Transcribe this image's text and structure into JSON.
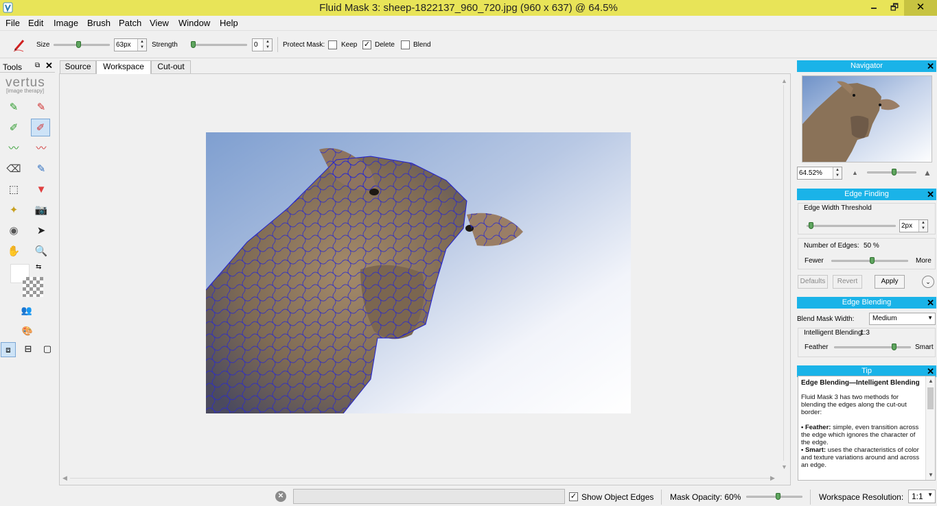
{
  "window": {
    "title": "Fluid Mask 3: sheep-1822137_960_720.jpg (960 x 637) @ 64.5%",
    "minimize_glyph": "🗕",
    "restore_glyph": "🗗",
    "close_glyph": "✕"
  },
  "menu": [
    "File",
    "Edit",
    "Image",
    "Brush",
    "Patch",
    "View",
    "Window",
    "Help"
  ],
  "toolbar": {
    "size_label": "Size",
    "size_value": "63px",
    "size_level": 0.4,
    "strength_label": "Strength",
    "strength_value": "0",
    "strength_level": 0.0,
    "protect_label": "Protect Mask:",
    "keep_label": "Keep",
    "keep_checked": false,
    "delete_label": "Delete",
    "delete_checked": true,
    "blend_label": "Blend",
    "blend_checked": false
  },
  "tools": {
    "header": "Tools",
    "logo": "vertus",
    "logo_sub": "[image therapy]"
  },
  "tabs": [
    {
      "label": "Source",
      "active": false
    },
    {
      "label": "Workspace",
      "active": true
    },
    {
      "label": "Cut-out",
      "active": false
    }
  ],
  "navigator": {
    "title": "Navigator",
    "zoom_value": "64.52%",
    "zoom_level": 0.5
  },
  "edge_finding": {
    "title": "Edge Finding",
    "threshold_label": "Edge Width Threshold",
    "threshold_value": "2px",
    "threshold_level": 0.0,
    "edges_label": "Number of Edges:",
    "edges_value": "50 %",
    "edges_level": 0.5,
    "fewer_label": "Fewer",
    "more_label": "More",
    "defaults_label": "Defaults",
    "revert_label": "Revert",
    "apply_label": "Apply"
  },
  "edge_blending": {
    "title": "Edge Blending",
    "width_label": "Blend Mask Width:",
    "width_value": "Medium",
    "intelligent_label": "Intelligent Blending:",
    "intelligent_value": "1:3",
    "intelligent_level": 0.75,
    "feather_label": "Feather",
    "smart_label": "Smart"
  },
  "tip": {
    "title": "Tip",
    "heading": "Edge Blending—Intelligent Blending",
    "p1": "Fluid Mask 3 has two methods for blending the edges along the cut-out border:",
    "feather_term": "• Feather:",
    "feather_text": " simple, even transition across the edge which ignores the character of the edge.",
    "smart_term": "• Smart:",
    "smart_text": " uses the characteristics of color and texture variations around and across an edge."
  },
  "status": {
    "show_edges_label": "Show Object Edges",
    "show_edges_checked": true,
    "mask_opacity_label": "Mask Opacity: 60%",
    "mask_opacity_level": 0.6,
    "resolution_label": "Workspace Resolution:",
    "resolution_value": "1:1"
  }
}
